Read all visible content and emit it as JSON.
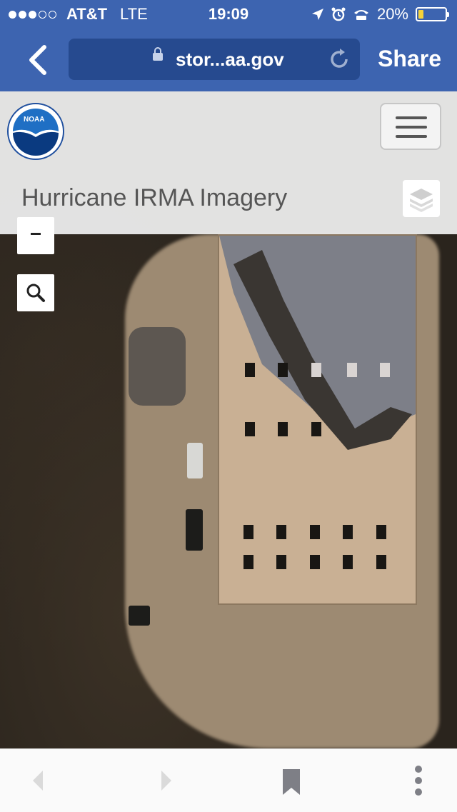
{
  "status_bar": {
    "carrier": "AT&T",
    "network": "LTE",
    "time": "19:09",
    "battery": "20%",
    "battery_level": 0.2,
    "signal_bars_filled": 3,
    "signal_bars_total": 5
  },
  "browser": {
    "url": "stor...aa.gov",
    "share_label": "Share"
  },
  "page": {
    "title": "Hurricane IRMA Imagery",
    "logo_text": "NOAA"
  },
  "colors": {
    "chrome": "#3d64b0",
    "url_bar": "#264a8f",
    "battery_fill": "#f7d33a"
  },
  "icons": [
    "back-chevron-icon",
    "lock-icon",
    "reload-icon",
    "noaa-logo",
    "hamburger-menu-icon",
    "layers-icon",
    "zoom-out-icon",
    "search-icon",
    "nav-back-icon",
    "nav-forward-icon",
    "bookmark-icon",
    "more-icon"
  ]
}
